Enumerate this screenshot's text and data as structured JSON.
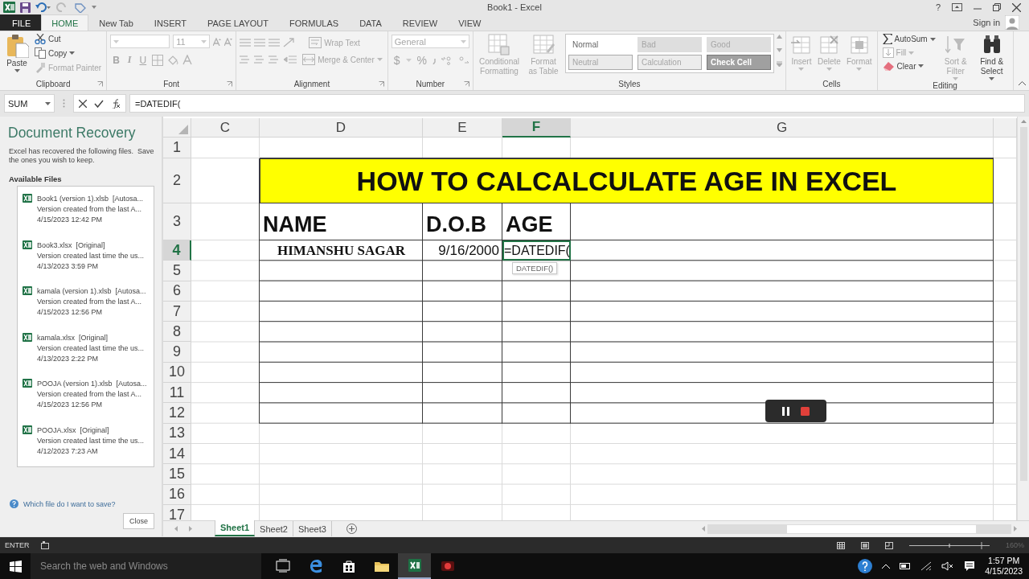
{
  "window": {
    "title": "Book1 - Excel",
    "help": "?",
    "sign_in": "Sign in"
  },
  "ribbon_tabs": [
    {
      "label": "FILE",
      "kind": "file",
      "selected": false
    },
    {
      "label": "HOME",
      "kind": "tab",
      "selected": true
    },
    {
      "label": "New Tab",
      "kind": "tab",
      "selected": false
    },
    {
      "label": "INSERT",
      "kind": "tab",
      "selected": false
    },
    {
      "label": "PAGE LAYOUT",
      "kind": "tab",
      "selected": false
    },
    {
      "label": "FORMULAS",
      "kind": "tab",
      "selected": false
    },
    {
      "label": "DATA",
      "kind": "tab",
      "selected": false
    },
    {
      "label": "REVIEW",
      "kind": "tab",
      "selected": false
    },
    {
      "label": "VIEW",
      "kind": "tab",
      "selected": false
    }
  ],
  "ribbon_groups": [
    {
      "label": "Clipboard",
      "buttons": [
        {
          "label": "Paste",
          "disabled": false
        },
        {
          "label": "Cut",
          "disabled": false
        },
        {
          "label": "Copy",
          "disabled": false
        },
        {
          "label": "Format Painter",
          "disabled": true
        }
      ]
    },
    {
      "label": "Font",
      "size": "11",
      "buttons": [
        {
          "label": "B",
          "disabled": true
        },
        {
          "label": "I",
          "disabled": true
        },
        {
          "label": "U",
          "disabled": true
        }
      ]
    },
    {
      "label": "Alignment",
      "buttons": [
        {
          "label": "Wrap Text",
          "disabled": true
        },
        {
          "label": "Merge & Center",
          "disabled": true
        }
      ]
    },
    {
      "label": "Number",
      "format": "General",
      "buttons": [
        {
          "label": "$",
          "disabled": true
        },
        {
          "label": "%",
          "disabled": true
        }
      ]
    },
    {
      "label": "Styles",
      "buttons": [
        {
          "label": "Conditional Formatting",
          "disabled": true
        },
        {
          "label": "Format as Table",
          "disabled": true
        }
      ],
      "cell_styles": [
        {
          "label": "Normal",
          "color": "#ffffff"
        },
        {
          "label": "Bad",
          "color": "#dedede"
        },
        {
          "label": "Good",
          "color": "#dedede"
        },
        {
          "label": "Neutral",
          "color": "#ebebeb"
        },
        {
          "label": "Calculation",
          "color": "#ececec"
        },
        {
          "label": "Check Cell",
          "color": "#a0a0a0"
        }
      ]
    },
    {
      "label": "Cells",
      "buttons": [
        {
          "label": "Insert",
          "disabled": true
        },
        {
          "label": "Delete",
          "disabled": true
        },
        {
          "label": "Format",
          "disabled": true
        }
      ]
    },
    {
      "label": "Editing",
      "buttons": [
        {
          "label": "AutoSum",
          "disabled": false
        },
        {
          "label": "Fill",
          "disabled": true
        },
        {
          "label": "Clear",
          "disabled": false
        },
        {
          "label": "Sort & Filter",
          "disabled": true
        },
        {
          "label": "Find & Select",
          "disabled": false
        }
      ]
    }
  ],
  "formula_bar": {
    "name_box": "SUM",
    "formula": "=DATEDIF("
  },
  "recovery": {
    "title": "Document Recovery",
    "message": "Excel has recovered the following files.  Save the ones you wish to keep.",
    "files_heading": "Available Files",
    "files": [
      {
        "name": "Book1 (version 1).xlsb  [Autosa...",
        "description": "Version created from the last A...",
        "date": "4/15/2023 12:42 PM"
      },
      {
        "name": "Book3.xlsx  [Original]",
        "description": "Version created last time the us...",
        "date": "4/13/2023 3:59 PM"
      },
      {
        "name": "kamala (version 1).xlsb  [Autosa...",
        "description": "Version created from the last A...",
        "date": "4/15/2023 12:56 PM"
      },
      {
        "name": "kamala.xlsx  [Original]",
        "description": "Version created last time the us...",
        "date": "4/13/2023 2:22 PM"
      },
      {
        "name": "POOJA (version 1).xlsb  [Autosa...",
        "description": "Version created from the last A...",
        "date": "4/15/2023 12:56 PM"
      },
      {
        "name": "POOJA.xlsx  [Original]",
        "description": "Version created last time the us...",
        "date": "4/12/2023 7:23 AM"
      }
    ],
    "help_link": "Which file do I want to save?",
    "close": "Close"
  },
  "sheet": {
    "columns": [
      {
        "label": "C",
        "selected": false
      },
      {
        "label": "D",
        "selected": false
      },
      {
        "label": "E",
        "selected": false
      },
      {
        "label": "F",
        "selected": true
      },
      {
        "label": "G",
        "selected": false
      }
    ],
    "rows": [
      {
        "label": "1",
        "selected": false
      },
      {
        "label": "2",
        "selected": false
      },
      {
        "label": "3",
        "selected": false
      },
      {
        "label": "4",
        "selected": true
      },
      {
        "label": "5",
        "selected": false
      },
      {
        "label": "6",
        "selected": false
      },
      {
        "label": "7",
        "selected": false
      },
      {
        "label": "8",
        "selected": false
      },
      {
        "label": "9",
        "selected": false
      },
      {
        "label": "10",
        "selected": false
      },
      {
        "label": "11",
        "selected": false
      },
      {
        "label": "12",
        "selected": false
      },
      {
        "label": "13",
        "selected": false
      },
      {
        "label": "14",
        "selected": false
      },
      {
        "label": "15",
        "selected": false
      },
      {
        "label": "16",
        "selected": false
      },
      {
        "label": "17",
        "selected": false
      }
    ],
    "title": "HOW TO CALCALCULATE AGE IN EXCEL",
    "header_cells": [
      "NAME",
      "D.O.B",
      "AGE"
    ],
    "data_row": [
      "HIMANSHU SAGAR",
      "9/16/2000",
      "=DATEDIF("
    ],
    "function_tooltip": "DATEDIF()"
  },
  "sheet_tabs": [
    {
      "label": "Sheet1",
      "selected": true
    },
    {
      "label": "Sheet2",
      "selected": false
    },
    {
      "label": "Sheet3",
      "selected": false
    }
  ],
  "status_bar": {
    "mode": "ENTER",
    "zoom": "160%"
  },
  "taskbar": {
    "search_placeholder": "Search the web and Windows",
    "time": "1:57 PM",
    "date": "4/15/2023"
  }
}
